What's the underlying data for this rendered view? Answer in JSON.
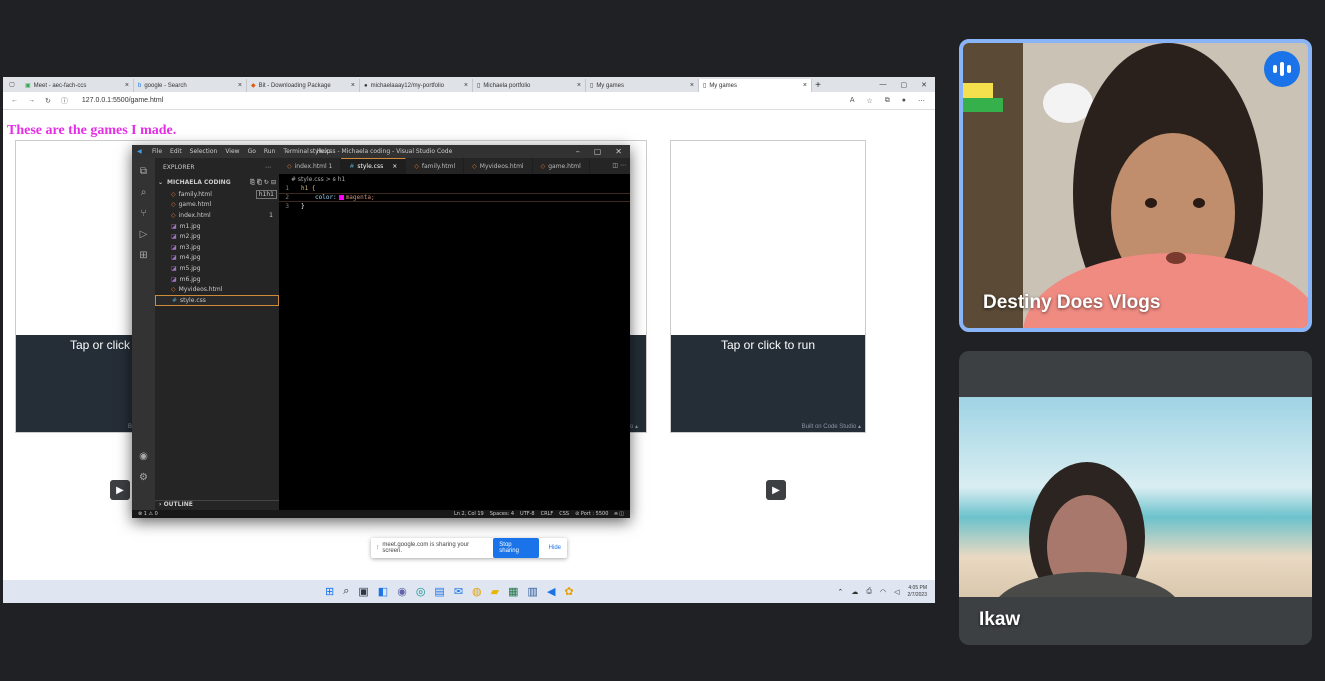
{
  "browser": {
    "tabs": [
      {
        "label": "Meet - aec-fach-ccs",
        "active": false
      },
      {
        "label": "google - Search",
        "active": false
      },
      {
        "label": "Bit - Downloading Package",
        "active": false
      },
      {
        "label": "michaelaaay12/my-portfolio",
        "active": false
      },
      {
        "label": "Michaela portfolio",
        "active": false
      },
      {
        "label": "My games",
        "active": false
      },
      {
        "label": "My games",
        "active": true
      }
    ],
    "url": "127.0.0.1:5500/game.html"
  },
  "page": {
    "heading": "These are the games I made.",
    "game_caption_left": "Tap or click",
    "game_caption_right": "Tap or click to run",
    "built_on": "Built on Code Studio ▴",
    "built_on_partial_left": "B",
    "built_on_partial_mid": "o ▴"
  },
  "vscode": {
    "menu": [
      "File",
      "Edit",
      "Selection",
      "View",
      "Go",
      "Run",
      "Terminal",
      "Help"
    ],
    "window_title": "style.css - Michaela coding - Visual Studio Code",
    "explorer_label": "EXPLORER",
    "folder": "MICHAELA CODING",
    "files": [
      "family.html",
      "game.html",
      "index.html",
      "m1.jpg",
      "m2.jpg",
      "m3.jpg",
      "m4.jpg",
      "m5.jpg",
      "m6.jpg",
      "Myvideos.html",
      "style.css"
    ],
    "selected_file": "style.css",
    "tooltip": "h1h1",
    "index_badge": "1",
    "outline": "OUTLINE",
    "editor_tabs": [
      "index.html 1",
      "style.css",
      "family.html",
      "Myvideos.html",
      "game.html"
    ],
    "breadcrumb": "# style.css > ꞩ h1",
    "code_selector": "h1 {",
    "code_prop": "color: ",
    "code_value": "magenta;",
    "code_close": "}",
    "status_left": "⊗ 1 ⚠ 0",
    "status_right": [
      "Ln 2, Col 19",
      "Spaces: 4",
      "UTF-8",
      "CRLF",
      "CSS",
      "⊘ Port : 5500"
    ]
  },
  "sharebar": {
    "text": "meet.google.com is sharing your screen.",
    "stop": "Stop sharing",
    "hide": "Hide"
  },
  "taskbar": {
    "time": "4:05 PM",
    "date": "2/7/2023"
  },
  "participants": [
    {
      "name": "Destiny Does Vlogs",
      "speaking": true
    },
    {
      "name": "Ikaw",
      "speaking": false
    }
  ],
  "colors": {
    "heading": "#e62ee6",
    "active_speaker_border": "#8ab4f8",
    "accent": "#1a73e8"
  }
}
